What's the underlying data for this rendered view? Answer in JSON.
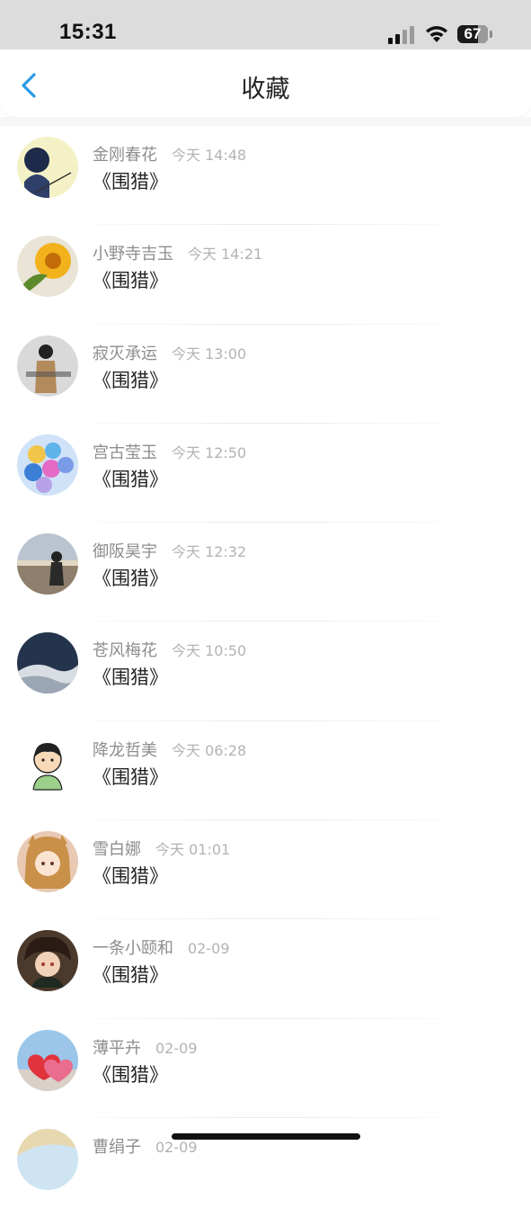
{
  "status_bar": {
    "time": "15:31",
    "battery": "67",
    "icons": [
      "signal-icon",
      "wifi-icon",
      "battery-icon"
    ]
  },
  "header": {
    "title": "收藏",
    "back_icon": "chevron-left-icon",
    "accent_color": "#2b9ae6"
  },
  "favorites": [
    {
      "name": "金刚春花",
      "time": "今天 14:48",
      "title": "《围猎》"
    },
    {
      "name": "小野寺吉玉",
      "time": "今天 14:21",
      "title": "《围猎》"
    },
    {
      "name": "寂灭承运",
      "time": "今天 13:00",
      "title": "《围猎》"
    },
    {
      "name": "宫古莹玉",
      "time": "今天 12:50",
      "title": "《围猎》"
    },
    {
      "name": "御阪昊宇",
      "time": "今天 12:32",
      "title": "《围猎》"
    },
    {
      "name": "苍风梅花",
      "time": "今天 10:50",
      "title": "《围猎》"
    },
    {
      "name": "降龙哲美",
      "time": "今天 06:28",
      "title": "《围猎》"
    },
    {
      "name": "雪白娜",
      "time": "今天 01:01",
      "title": "《围猎》"
    },
    {
      "name": "一条小颐和",
      "time": "02-09",
      "title": "《围猎》"
    },
    {
      "name": "薄平卉",
      "time": "02-09",
      "title": "《围猎》"
    },
    {
      "name": "曹绢子",
      "time": "02-09",
      "title": ""
    }
  ]
}
